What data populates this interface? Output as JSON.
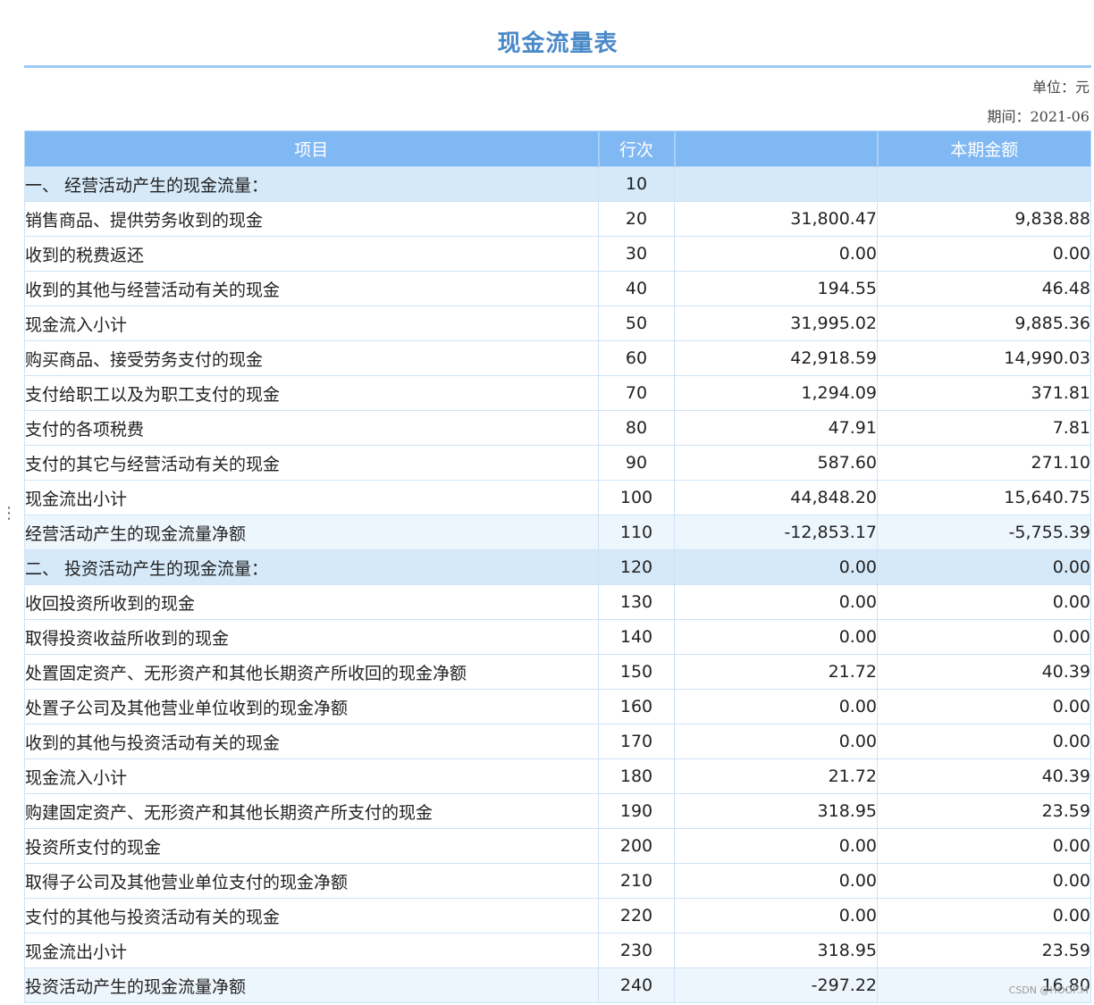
{
  "report": {
    "title": "现金流量表",
    "unit": "单位：元",
    "period": "期间：2021-06"
  },
  "table": {
    "headers": [
      "项目",
      "行次",
      "",
      "本期金额"
    ],
    "rows": [
      {
        "type": "section",
        "item": "一、 经营活动产生的现金流量：",
        "line": "10",
        "a": "",
        "b": ""
      },
      {
        "type": "detail",
        "item": "销售商品、提供劳务收到的现金",
        "line": "20",
        "a": "31,800.47",
        "b": "9,838.88"
      },
      {
        "type": "detail",
        "item": "收到的税费返还",
        "line": "30",
        "a": "0.00",
        "b": "0.00"
      },
      {
        "type": "detail",
        "item": "收到的其他与经营活动有关的现金",
        "line": "40",
        "a": "194.55",
        "b": "46.48"
      },
      {
        "type": "subtotal",
        "item": "现金流入小计",
        "line": "50",
        "a": "31,995.02",
        "b": "9,885.36"
      },
      {
        "type": "detail",
        "item": "购买商品、接受劳务支付的现金",
        "line": "60",
        "a": "42,918.59",
        "b": "14,990.03"
      },
      {
        "type": "detail",
        "item": "支付给职工以及为职工支付的现金",
        "line": "70",
        "a": "1,294.09",
        "b": "371.81"
      },
      {
        "type": "detail",
        "item": "支付的各项税费",
        "line": "80",
        "a": "47.91",
        "b": "7.81"
      },
      {
        "type": "detail",
        "item": "支付的其它与经营活动有关的现金",
        "line": "90",
        "a": "587.60",
        "b": "271.10"
      },
      {
        "type": "subtotal",
        "item": "现金流出小计",
        "line": "100",
        "a": "44,848.20",
        "b": "15,640.75"
      },
      {
        "type": "net",
        "item": "经营活动产生的现金流量净额",
        "line": "110",
        "a": "-12,853.17",
        "b": "-5,755.39"
      },
      {
        "type": "section",
        "item": "二、 投资活动产生的现金流量：",
        "line": "120",
        "a": "0.00",
        "b": "0.00"
      },
      {
        "type": "detail",
        "item": "收回投资所收到的现金",
        "line": "130",
        "a": "0.00",
        "b": "0.00"
      },
      {
        "type": "detail",
        "item": "取得投资收益所收到的现金",
        "line": "140",
        "a": "0.00",
        "b": "0.00"
      },
      {
        "type": "detail",
        "item": "处置固定资产、无形资产和其他长期资产所收回的现金净额",
        "line": "150",
        "a": "21.72",
        "b": "40.39"
      },
      {
        "type": "detail",
        "item": "处置子公司及其他营业单位收到的现金净额",
        "line": "160",
        "a": "0.00",
        "b": "0.00"
      },
      {
        "type": "detail",
        "item": "收到的其他与投资活动有关的现金",
        "line": "170",
        "a": "0.00",
        "b": "0.00"
      },
      {
        "type": "subtotal",
        "item": "现金流入小计",
        "line": "180",
        "a": "21.72",
        "b": "40.39"
      },
      {
        "type": "detail",
        "item": "购建固定资产、无形资产和其他长期资产所支付的现金",
        "line": "190",
        "a": "318.95",
        "b": "23.59"
      },
      {
        "type": "detail",
        "item": "投资所支付的现金",
        "line": "200",
        "a": "0.00",
        "b": "0.00"
      },
      {
        "type": "detail",
        "item": "取得子公司及其他营业单位支付的现金净额",
        "line": "210",
        "a": "0.00",
        "b": "0.00"
      },
      {
        "type": "detail",
        "item": "支付的其他与投资活动有关的现金",
        "line": "220",
        "a": "0.00",
        "b": "0.00"
      },
      {
        "type": "subtotal",
        "item": "现金流出小计",
        "line": "230",
        "a": "318.95",
        "b": "23.59"
      },
      {
        "type": "net",
        "item": "投资活动产生的现金流量净额",
        "line": "240",
        "a": "-297.22",
        "b": "16.80"
      }
    ]
  },
  "watermark": "CSDN @HOOP.M",
  "colors": {
    "title": "#4a89c8",
    "header_bg": "#80b8f4",
    "section_bg": "#d6e9f9",
    "net_bg": "#eef6fd",
    "grid": "#cfe3f6"
  }
}
